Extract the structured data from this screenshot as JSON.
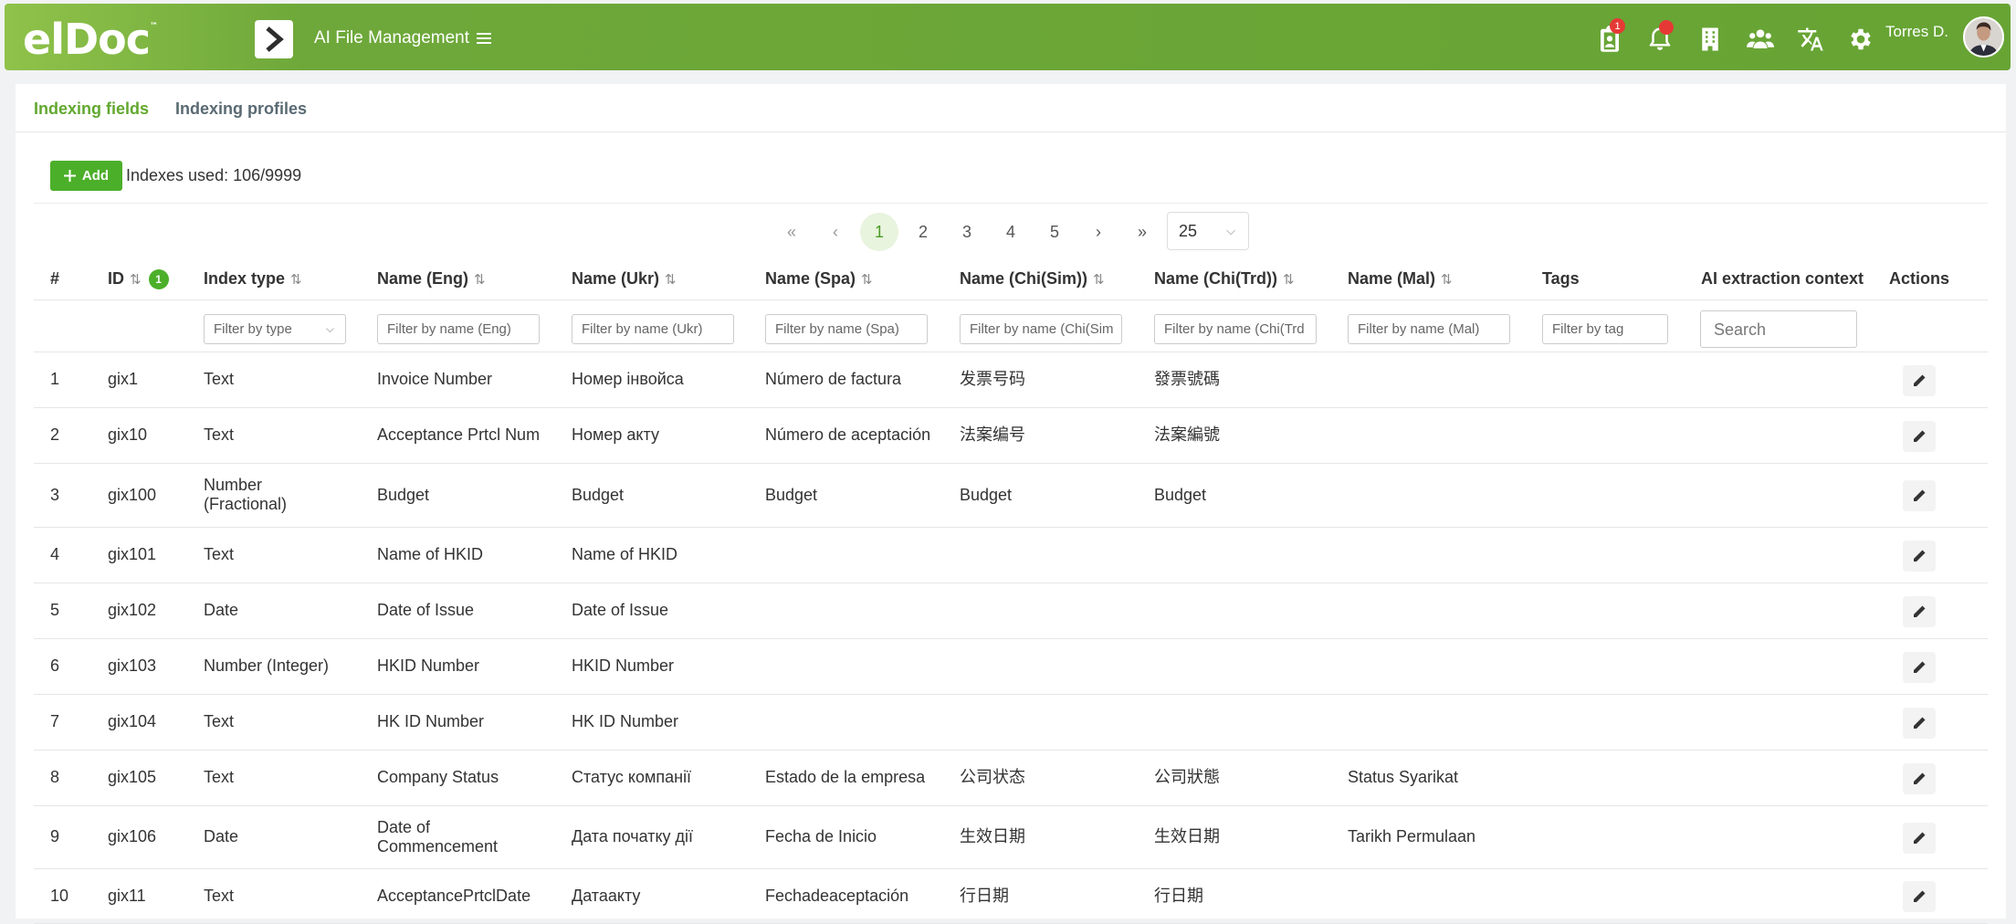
{
  "header": {
    "logo": "elDoc",
    "logo_tm": "™",
    "app_title": "AI File Management",
    "tasks_badge": "1",
    "user_name": "Torres D."
  },
  "tabs": [
    {
      "label": "Indexing fields",
      "active": true
    },
    {
      "label": "Indexing profiles",
      "active": false
    }
  ],
  "toolbar": {
    "add_label": "Add",
    "indexes_used": "Indexes used: 106/9999"
  },
  "pagination": {
    "first": "«",
    "prev": "‹",
    "pages": [
      "1",
      "2",
      "3",
      "4",
      "5"
    ],
    "current": "1",
    "next": "›",
    "last": "»",
    "page_size": "25"
  },
  "columns": {
    "num": "#",
    "id": "ID",
    "id_sort_badge": "1",
    "index_type": "Index type",
    "name_eng": "Name (Eng)",
    "name_ukr": "Name (Ukr)",
    "name_spa": "Name (Spa)",
    "name_chi_sim": "Name (Chi(Sim))",
    "name_chi_trd": "Name (Chi(Trd))",
    "name_mal": "Name (Mal)",
    "tags": "Tags",
    "ai_context": "AI extraction context",
    "actions": "Actions"
  },
  "filters": {
    "type": "Filter by type",
    "eng": "Filter by name (Eng)",
    "ukr": "Filter by name (Ukr)",
    "spa": "Filter by name (Spa)",
    "chi_sim": "Filter by name (Chi(Sim",
    "chi_trd": "Filter by name (Chi(Trd",
    "mal": "Filter by name (Mal)",
    "tag": "Filter by tag",
    "search": "Search"
  },
  "rows": [
    {
      "num": "1",
      "id": "gix1",
      "type": [
        "Text"
      ],
      "eng": [
        "Invoice Number"
      ],
      "ukr": "Номер інвойса",
      "spa": "Número de factura",
      "chi_sim": "发票号码",
      "chi_trd": "發票號碼",
      "mal": ""
    },
    {
      "num": "2",
      "id": "gix10",
      "type": [
        "Text"
      ],
      "eng": [
        "Acceptance Prtcl Num"
      ],
      "ukr": "Номер акту",
      "spa": "Número de aceptación",
      "chi_sim": "法案编号",
      "chi_trd": "法案編號",
      "mal": ""
    },
    {
      "num": "3",
      "id": "gix100",
      "type": [
        "Number",
        "(Fractional)"
      ],
      "eng": [
        "Budget"
      ],
      "ukr": "Budget",
      "spa": "Budget",
      "chi_sim": "Budget",
      "chi_trd": "Budget",
      "mal": ""
    },
    {
      "num": "4",
      "id": "gix101",
      "type": [
        "Text"
      ],
      "eng": [
        "Name of HKID"
      ],
      "ukr": "Name of HKID",
      "spa": "",
      "chi_sim": "",
      "chi_trd": "",
      "mal": ""
    },
    {
      "num": "5",
      "id": "gix102",
      "type": [
        "Date"
      ],
      "eng": [
        "Date of Issue"
      ],
      "ukr": "Date of Issue",
      "spa": "",
      "chi_sim": "",
      "chi_trd": "",
      "mal": ""
    },
    {
      "num": "6",
      "id": "gix103",
      "type": [
        "Number (Integer)"
      ],
      "eng": [
        "HKID Number"
      ],
      "ukr": "HKID Number",
      "spa": "",
      "chi_sim": "",
      "chi_trd": "",
      "mal": ""
    },
    {
      "num": "7",
      "id": "gix104",
      "type": [
        "Text"
      ],
      "eng": [
        "HK ID Number"
      ],
      "ukr": "HK ID Number",
      "spa": "",
      "chi_sim": "",
      "chi_trd": "",
      "mal": ""
    },
    {
      "num": "8",
      "id": "gix105",
      "type": [
        "Text"
      ],
      "eng": [
        "Company Status"
      ],
      "ukr": "Статус компанії",
      "spa": "Estado de la empresa",
      "chi_sim": "公司状态",
      "chi_trd": "公司狀態",
      "mal": "Status Syarikat"
    },
    {
      "num": "9",
      "id": "gix106",
      "type": [
        "Date"
      ],
      "eng": [
        "Date of",
        "Commencement"
      ],
      "ukr": "Дата початку дії",
      "spa": "Fecha de Inicio",
      "chi_sim": "生效日期",
      "chi_trd": "生效日期",
      "mal": "Tarikh Permulaan"
    },
    {
      "num": "10",
      "id": "gix11",
      "type": [
        "Text"
      ],
      "eng": [
        "AcceptancePrtclDate"
      ],
      "ukr": "Датаакту",
      "spa": "Fechadeaceptación",
      "chi_sim": "行日期",
      "chi_trd": "行日期",
      "mal": ""
    }
  ]
}
